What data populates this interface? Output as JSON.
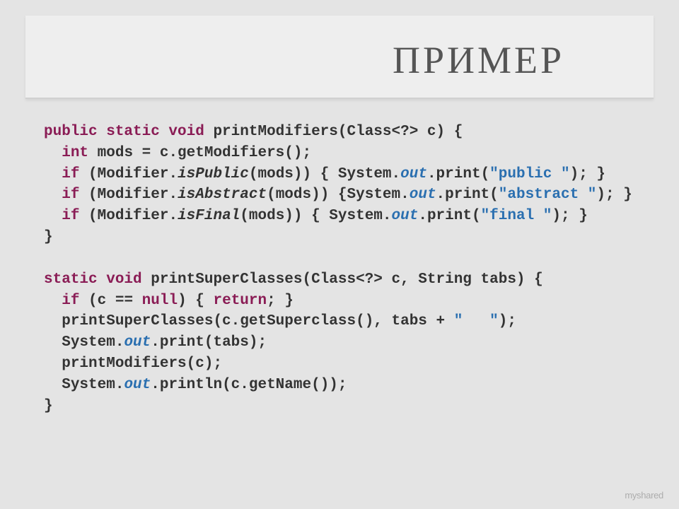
{
  "slide": {
    "title": "ПРИМЕР"
  },
  "code": {
    "lines": [
      {
        "indent": 0,
        "tokens": [
          {
            "cls": "kw",
            "t": "public static void"
          },
          {
            "cls": "",
            "t": " "
          },
          {
            "cls": "id",
            "t": "printModifiers(Class<?> c) {"
          }
        ]
      },
      {
        "indent": 1,
        "tokens": [
          {
            "cls": "kw",
            "t": "int"
          },
          {
            "cls": "",
            "t": " mods = c.getModifiers();"
          }
        ]
      },
      {
        "indent": 1,
        "tokens": [
          {
            "cls": "kw",
            "t": "if"
          },
          {
            "cls": "",
            "t": " (Modifier."
          },
          {
            "cls": "call",
            "t": "isPublic"
          },
          {
            "cls": "",
            "t": "(mods)) { System."
          },
          {
            "cls": "fld",
            "t": "out"
          },
          {
            "cls": "",
            "t": ".print("
          },
          {
            "cls": "str",
            "t": "\"public \""
          },
          {
            "cls": "",
            "t": "); }"
          }
        ]
      },
      {
        "indent": 1,
        "tokens": [
          {
            "cls": "kw",
            "t": "if"
          },
          {
            "cls": "",
            "t": " (Modifier."
          },
          {
            "cls": "call",
            "t": "isAbstract"
          },
          {
            "cls": "",
            "t": "(mods)) {System."
          },
          {
            "cls": "fld",
            "t": "out"
          },
          {
            "cls": "",
            "t": ".print("
          },
          {
            "cls": "str",
            "t": "\"abstract \""
          },
          {
            "cls": "",
            "t": "); }"
          }
        ]
      },
      {
        "indent": 1,
        "tokens": [
          {
            "cls": "kw",
            "t": "if"
          },
          {
            "cls": "",
            "t": " (Modifier."
          },
          {
            "cls": "call",
            "t": "isFinal"
          },
          {
            "cls": "",
            "t": "(mods)) { System."
          },
          {
            "cls": "fld",
            "t": "out"
          },
          {
            "cls": "",
            "t": ".print("
          },
          {
            "cls": "str",
            "t": "\"final \""
          },
          {
            "cls": "",
            "t": "); }"
          }
        ]
      },
      {
        "indent": 0,
        "tokens": [
          {
            "cls": "",
            "t": "}"
          }
        ]
      },
      {
        "indent": 0,
        "tokens": [
          {
            "cls": "",
            "t": " "
          }
        ]
      },
      {
        "indent": 0,
        "tokens": [
          {
            "cls": "kw",
            "t": "static void"
          },
          {
            "cls": "",
            "t": " "
          },
          {
            "cls": "id",
            "t": "printSuperClasses(Class<?> c, String tabs) {"
          }
        ]
      },
      {
        "indent": 1,
        "tokens": [
          {
            "cls": "kw",
            "t": "if"
          },
          {
            "cls": "",
            "t": " (c == "
          },
          {
            "cls": "kw",
            "t": "null"
          },
          {
            "cls": "",
            "t": ") { "
          },
          {
            "cls": "kw",
            "t": "return"
          },
          {
            "cls": "",
            "t": "; }"
          }
        ]
      },
      {
        "indent": 1,
        "tokens": [
          {
            "cls": "",
            "t": "printSuperClasses(c.getSuperclass(), tabs + "
          },
          {
            "cls": "str",
            "t": "\"   \""
          },
          {
            "cls": "",
            "t": ");"
          }
        ]
      },
      {
        "indent": 1,
        "tokens": [
          {
            "cls": "",
            "t": "System."
          },
          {
            "cls": "fld",
            "t": "out"
          },
          {
            "cls": "",
            "t": ".print(tabs);"
          }
        ]
      },
      {
        "indent": 1,
        "tokens": [
          {
            "cls": "",
            "t": "printModifiers(c);"
          }
        ]
      },
      {
        "indent": 1,
        "tokens": [
          {
            "cls": "",
            "t": "System."
          },
          {
            "cls": "fld",
            "t": "out"
          },
          {
            "cls": "",
            "t": ".println(c.getName());"
          }
        ]
      },
      {
        "indent": 0,
        "tokens": [
          {
            "cls": "",
            "t": "}"
          }
        ]
      }
    ]
  },
  "watermark": "myshared"
}
